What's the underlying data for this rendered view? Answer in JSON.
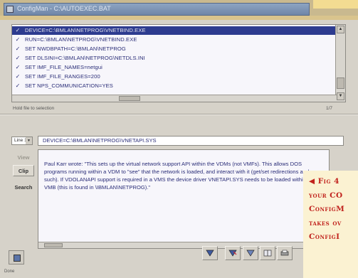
{
  "window": {
    "title": "ConfigMan - C:\\AUTOEXEC.BAT"
  },
  "list": {
    "rows": [
      {
        "checked": "✓",
        "text": "DEVICE=C:\\BMLAN\\NETPROG\\VNETBIND.EXE",
        "selected": true
      },
      {
        "checked": "✓",
        "text": "RUN=C:\\BMLAN\\NETPROG\\VNETBIND.EXE",
        "selected": false
      },
      {
        "checked": "✓",
        "text": "SET NWDBPATH=C:\\BMLAN\\NETPROG",
        "selected": false
      },
      {
        "checked": "✓",
        "text": "SET DLSINI=C:\\BMLAN\\NETPROG\\NETDLS.INI",
        "selected": false
      },
      {
        "checked": "✓",
        "text": "SET IMF_FILE_NAMES=netgui",
        "selected": false
      },
      {
        "checked": "✓",
        "text": "SET IMF_FILE_RANGES=200",
        "selected": false
      },
      {
        "checked": "✓",
        "text": "SET NPS_COMMUNICATION=YES",
        "selected": false
      }
    ],
    "status_left": "Hold file to selection",
    "status_right": "1/7"
  },
  "editor": {
    "combo_value": "Line 1",
    "command": "DEVICE=C:\\BMLAN\\NETPROG\\VNETAPI.SYS",
    "buttons": {
      "view": "View",
      "clip": "Clip",
      "search": "Search"
    },
    "notes": "Paul Karr wrote: \"This sets up the virtual network support API within the VDMs (not VMFs). This allows DOS programs running within a VDM to \"see\" that the network is loaded, and interact with it (get/set redirections and such). If VDOLANAPI support is required in a VMS the device driver VNETAPI.SYS needs to be loaded within the VMB (this is found in \\IBMLAN\\NETPROG).\""
  },
  "bottom": {
    "label": "Done"
  },
  "caption": {
    "fig": "◀ Fig 4",
    "lines": [
      "your CO",
      "ConfigM",
      "takes ov",
      "ConfigI"
    ]
  }
}
